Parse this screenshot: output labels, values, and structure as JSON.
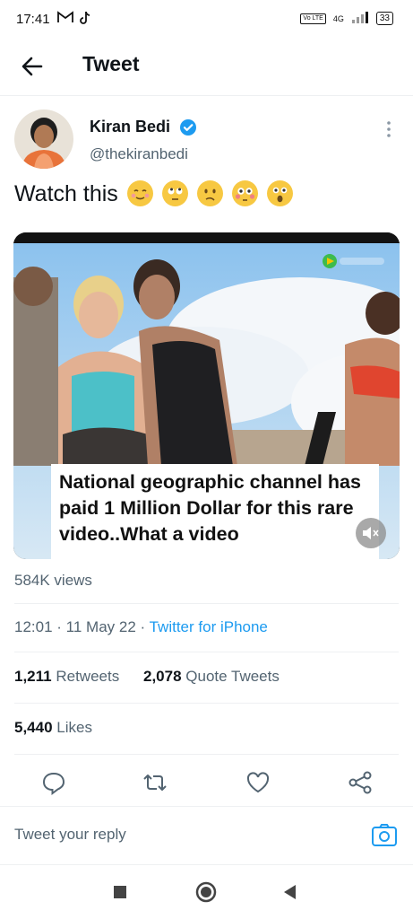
{
  "status_bar": {
    "time": "17:41",
    "network": "4G",
    "volte": "Vo LTE",
    "battery": "33"
  },
  "header": {
    "title": "Tweet"
  },
  "tweet": {
    "author_name": "Kiran Bedi",
    "handle": "@thekiranbedi",
    "text": "Watch this",
    "emoji_icons": [
      "relieved-face-icon",
      "rolling-eyes-face-icon",
      "confused-face-icon",
      "flushed-face-icon",
      "astonished-face-icon"
    ],
    "media": {
      "caption": "National geographic channel has paid 1 Million Dollar for this rare  video..What a video"
    },
    "views": "584K views",
    "time": "12:01",
    "date": "11 May 22",
    "source": "Twitter for iPhone",
    "retweets_count": "1,211",
    "retweets_label": "Retweets",
    "quotes_count": "2,078",
    "quotes_label": "Quote Tweets",
    "likes_count": "5,440",
    "likes_label": "Likes"
  },
  "reply": {
    "placeholder": "Tweet your reply"
  },
  "colors": {
    "accent": "#1d9bf0",
    "text": "#0f1419",
    "secondary": "#536471"
  }
}
